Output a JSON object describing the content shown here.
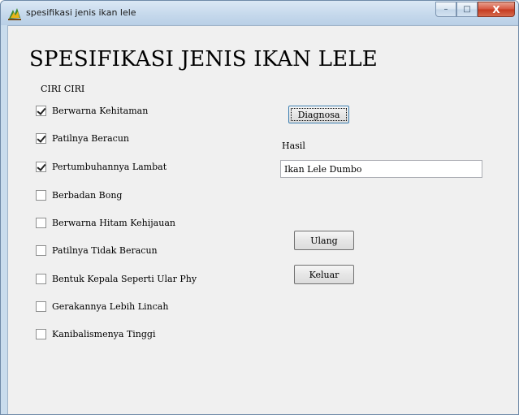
{
  "window": {
    "title": "spesifikasi jenis ikan lele",
    "icon": "app-icon",
    "caption": {
      "minimize": "–",
      "maximize": "□",
      "close": "X"
    }
  },
  "main": {
    "heading": "SPESIFIKASI JENIS IKAN LELE",
    "section_label": "CIRI CIRI",
    "checkboxes": [
      {
        "label": "Berwarna Kehitaman",
        "checked": true
      },
      {
        "label": "Patilnya Beracun",
        "checked": true
      },
      {
        "label": "Pertumbuhannya Lambat",
        "checked": true
      },
      {
        "label": "Berbadan Bong",
        "checked": false
      },
      {
        "label": "Berwarna Hitam Kehijauan",
        "checked": false
      },
      {
        "label": "Patilnya Tidak Beracun",
        "checked": false
      },
      {
        "label": "Bentuk Kepala Seperti Ular Phy",
        "checked": false
      },
      {
        "label": "Gerakannya Lebih Lincah",
        "checked": false
      },
      {
        "label": "Kanibalismenya Tinggi",
        "checked": false
      }
    ],
    "diagnosa_button": "Diagnosa",
    "hasil_label": "Hasil",
    "hasil_value": "Ikan Lele Dumbo",
    "ulang_button": "Ulang",
    "keluar_button": "Keluar"
  },
  "colors": {
    "titlebar": "#c6d9ec",
    "client_background": "#f0f0f0",
    "close_button": "#c4391f"
  }
}
